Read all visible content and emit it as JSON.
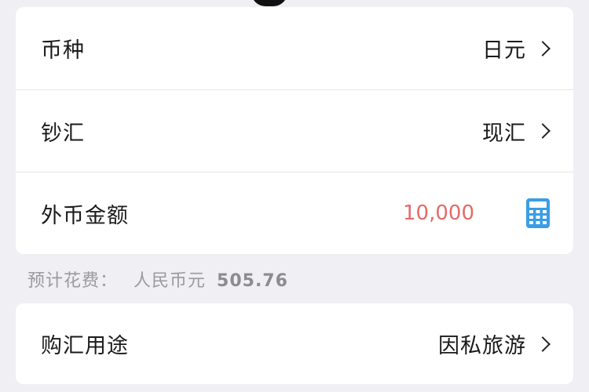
{
  "form": {
    "currency": {
      "label": "币种",
      "value": "日元"
    },
    "cash_type": {
      "label": "钞汇",
      "value": "现汇"
    },
    "amount": {
      "label": "外币金额",
      "value": "10,000"
    }
  },
  "estimate": {
    "prefix": "预计花费：",
    "currency": "人民币元",
    "amount": "505.76"
  },
  "purpose": {
    "label": "购汇用途",
    "value": "因私旅游"
  },
  "colors": {
    "amount": "#e46b6b",
    "calculator_icon": "#3a9ee4",
    "background": "#efeff4"
  },
  "icons": [
    "chevron-right-icon",
    "calculator-icon"
  ]
}
